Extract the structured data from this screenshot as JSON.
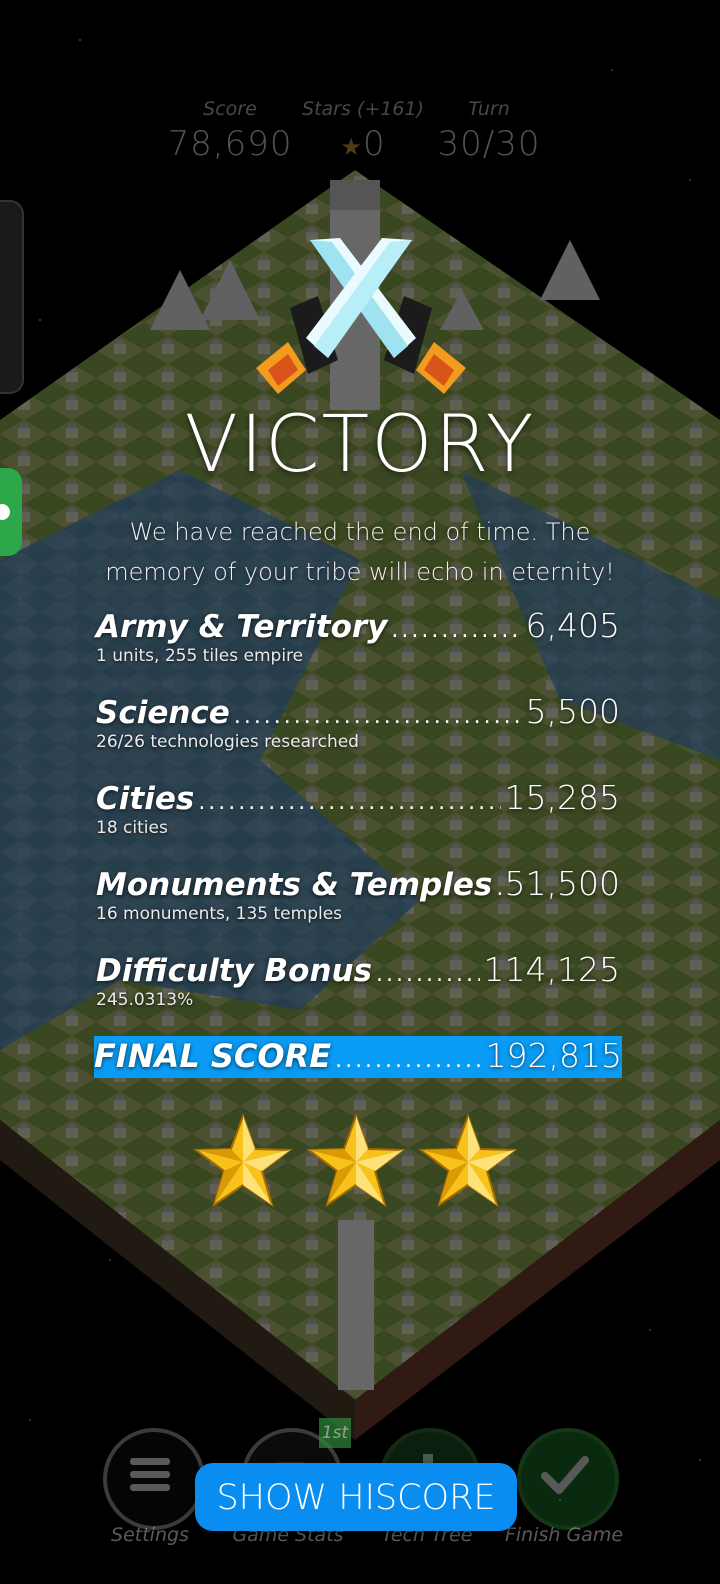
{
  "top_stats": {
    "score": {
      "label": "Score",
      "value": "78,690"
    },
    "stars": {
      "label": "Stars (+161)",
      "value": "0",
      "icon": "star-icon"
    },
    "turn": {
      "label": "Turn",
      "value": "30/30"
    }
  },
  "victory": {
    "title": "VICTORY",
    "message": "We have reached the end of time. The memory of your tribe will echo in eternity!",
    "icon": "crossed-swords-icon"
  },
  "score_breakdown": [
    {
      "label": "Army & Territory",
      "value": "6,405",
      "detail": "1 units, 255 tiles empire"
    },
    {
      "label": "Science",
      "value": "5,500",
      "detail": "26/26 technologies researched"
    },
    {
      "label": "Cities",
      "value": "15,285",
      "detail": "18 cities"
    },
    {
      "label": "Monuments & Temples",
      "value": "51,500",
      "detail": "16 monuments, 135 temples"
    },
    {
      "label": "Difficulty Bonus",
      "value": "114,125",
      "detail": "245.0313%"
    }
  ],
  "final_score": {
    "label": "FINAL SCORE",
    "value": "192,815"
  },
  "rating": {
    "stars_earned": 3,
    "stars_max": 3
  },
  "bottom_nav": {
    "items": [
      {
        "label": "Settings",
        "icon": "menu-icon"
      },
      {
        "label": "Game Stats",
        "icon": "stats-icon"
      },
      {
        "label": "Tech Tree",
        "icon": "tech-tree-icon"
      },
      {
        "label": "Finish Game",
        "icon": "checkmark-icon"
      }
    ],
    "rank_badge": "1st"
  },
  "show_hiscore_label": "SHOW HISCORE",
  "colors": {
    "accent_blue": "#0a9cf5",
    "button_blue": "#0a8df0",
    "star_gold": "#f7c21b"
  }
}
